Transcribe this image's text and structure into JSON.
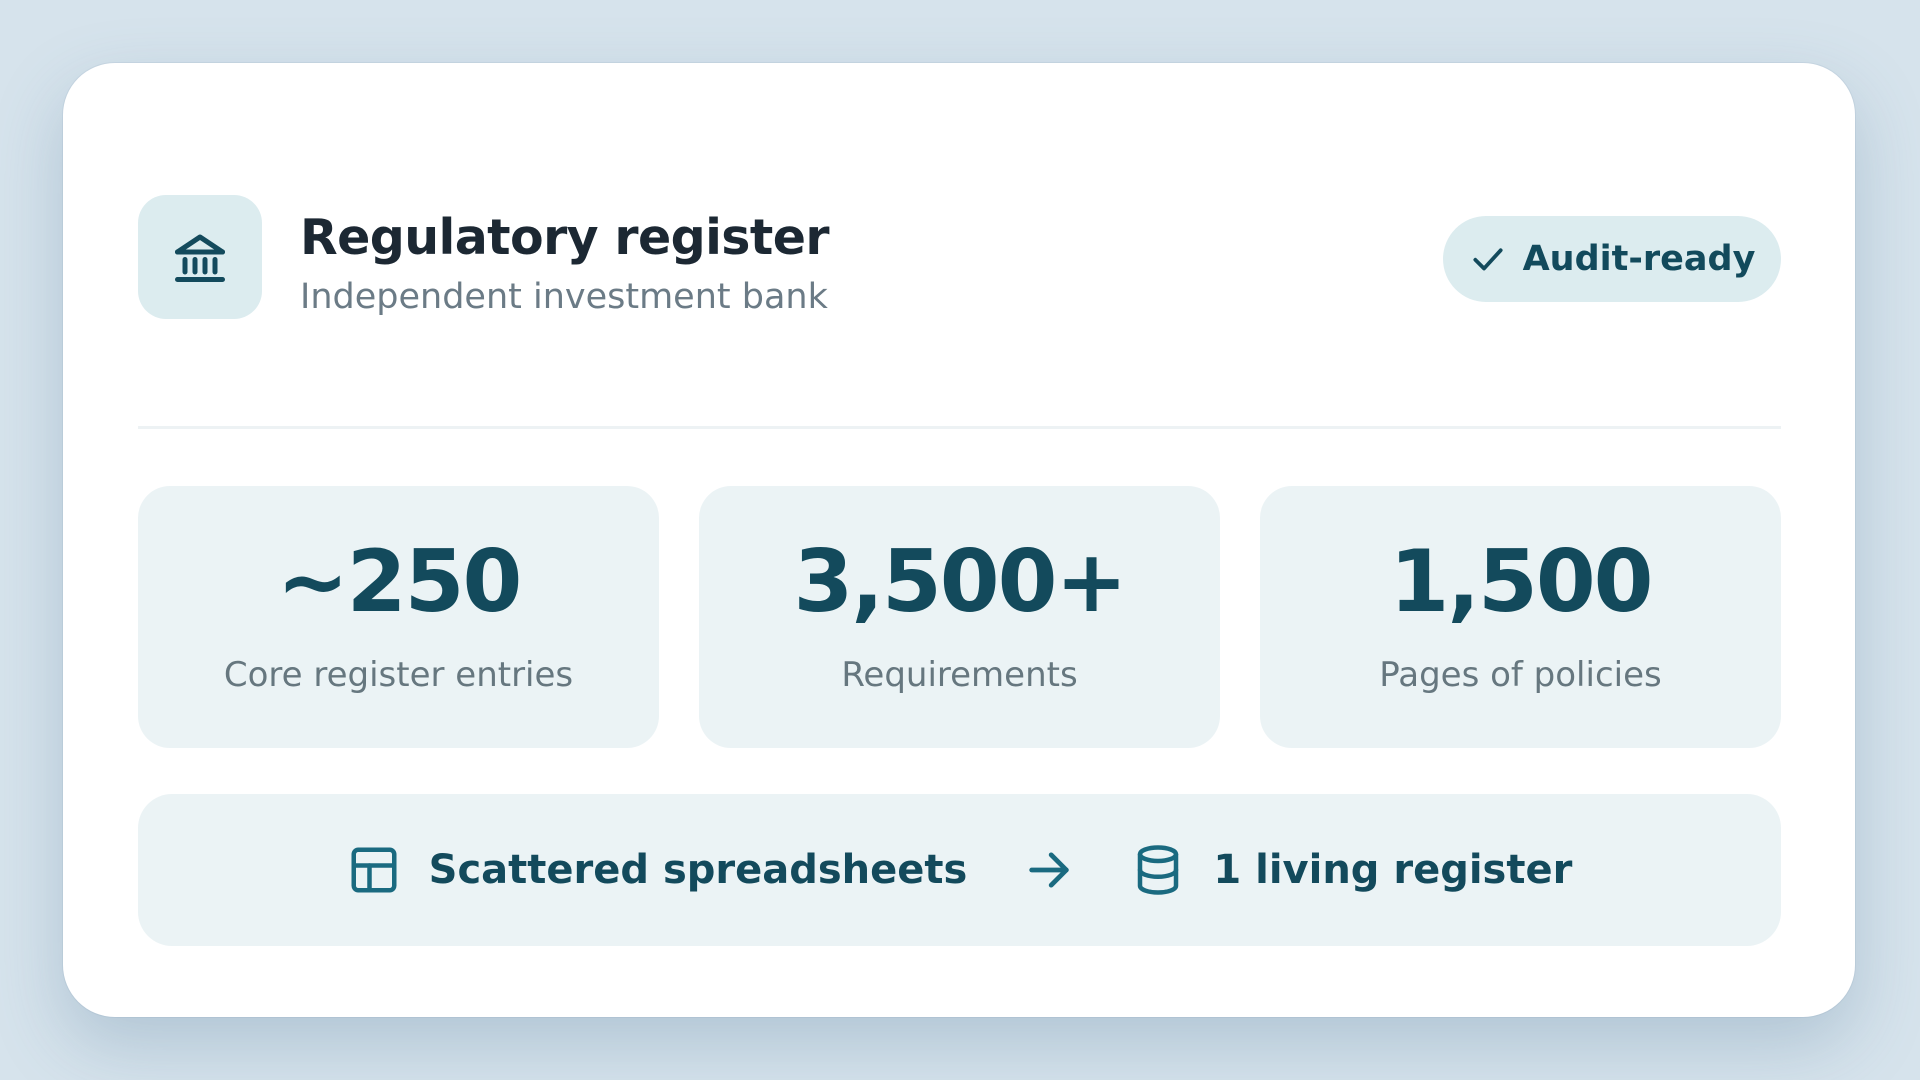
{
  "header": {
    "title": "Regulatory register",
    "subtitle": "Independent investment bank",
    "logo_icon": "bank-building-icon",
    "badge": {
      "icon": "check-icon",
      "label": "Audit-ready"
    }
  },
  "stats": [
    {
      "value": "~250",
      "label": "Core register entries"
    },
    {
      "value": "3,500+",
      "label": "Requirements"
    },
    {
      "value": "1,500",
      "label": "Pages of policies"
    }
  ],
  "transformation": {
    "from": {
      "icon": "table-icon",
      "label": "Scattered spreadsheets"
    },
    "arrow_icon": "arrow-right-icon",
    "to": {
      "icon": "database-icon",
      "label": "1 living register"
    }
  },
  "colors": {
    "background": "#d6e3ec",
    "card": "#ffffff",
    "accent": "#134a5c",
    "tile": "#ebf3f5",
    "muted_text": "#66777f"
  }
}
